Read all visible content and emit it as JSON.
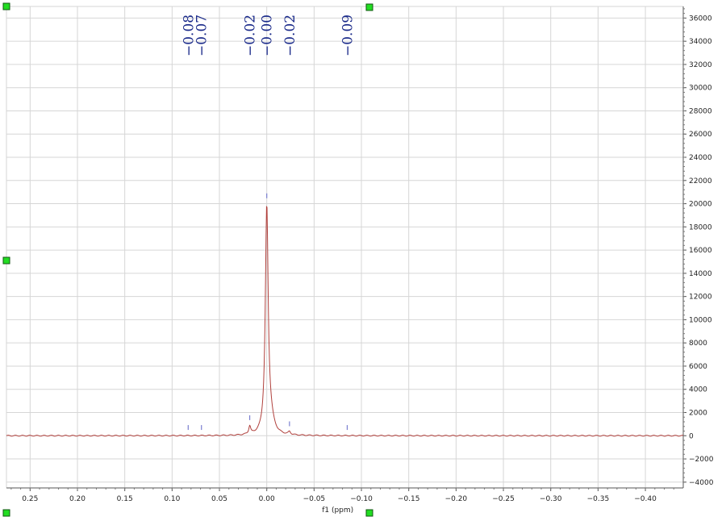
{
  "chart_data": {
    "type": "line",
    "title": "",
    "xlabel": "f1 (ppm)",
    "ylabel": "",
    "xlim": [
      0.275,
      -0.44
    ],
    "ylim": [
      -4500,
      37000
    ],
    "x_reversed": true,
    "grid": true,
    "x_ticks": [
      0.25,
      0.2,
      0.15,
      0.1,
      0.05,
      0.0,
      -0.05,
      -0.1,
      -0.15,
      -0.2,
      -0.25,
      -0.3,
      -0.35,
      -0.4
    ],
    "x_tick_labels": [
      "0.25",
      "0.20",
      "0.15",
      "0.10",
      "0.05",
      "0.00",
      "−0.05",
      "−0.10",
      "−0.15",
      "−0.20",
      "−0.25",
      "−0.30",
      "−0.35",
      "−0.40"
    ],
    "y_ticks": [
      -4000,
      -2000,
      0,
      2000,
      4000,
      6000,
      8000,
      10000,
      12000,
      14000,
      16000,
      18000,
      20000,
      22000,
      24000,
      26000,
      28000,
      30000,
      32000,
      34000,
      36000
    ],
    "y_tick_labels": [
      "−4000",
      "−2000",
      "0",
      "2000",
      "4000",
      "6000",
      "8000",
      "10000",
      "12000",
      "14000",
      "16000",
      "18000",
      "20000",
      "22000",
      "24000",
      "26000",
      "28000",
      "30000",
      "32000",
      "34000",
      "36000"
    ],
    "peak_labels": [
      {
        "x": 0.083,
        "text": "−0.08"
      },
      {
        "x": 0.069,
        "text": "−0.07"
      },
      {
        "x": 0.018,
        "text": "−0.02"
      },
      {
        "x": 0.0,
        "text": "−0.00"
      },
      {
        "x": -0.024,
        "text": "−0.02"
      },
      {
        "x": -0.085,
        "text": "−0.09"
      }
    ],
    "peaks": [
      {
        "x": 0.0,
        "height": 19500,
        "width": 0.0018
      },
      {
        "x": 0.018,
        "height": 700,
        "width": 0.0012
      },
      {
        "x": -0.024,
        "height": 250,
        "width": 0.0014
      },
      {
        "x": -0.004,
        "height": 1100,
        "width": 0.004
      }
    ],
    "colors": {
      "spectrum": "#b0403c",
      "label": "#1a2a8a",
      "tick_mark": "#7a7fd0",
      "grid": "#d6d6d6",
      "handle": "#22dd22"
    }
  }
}
